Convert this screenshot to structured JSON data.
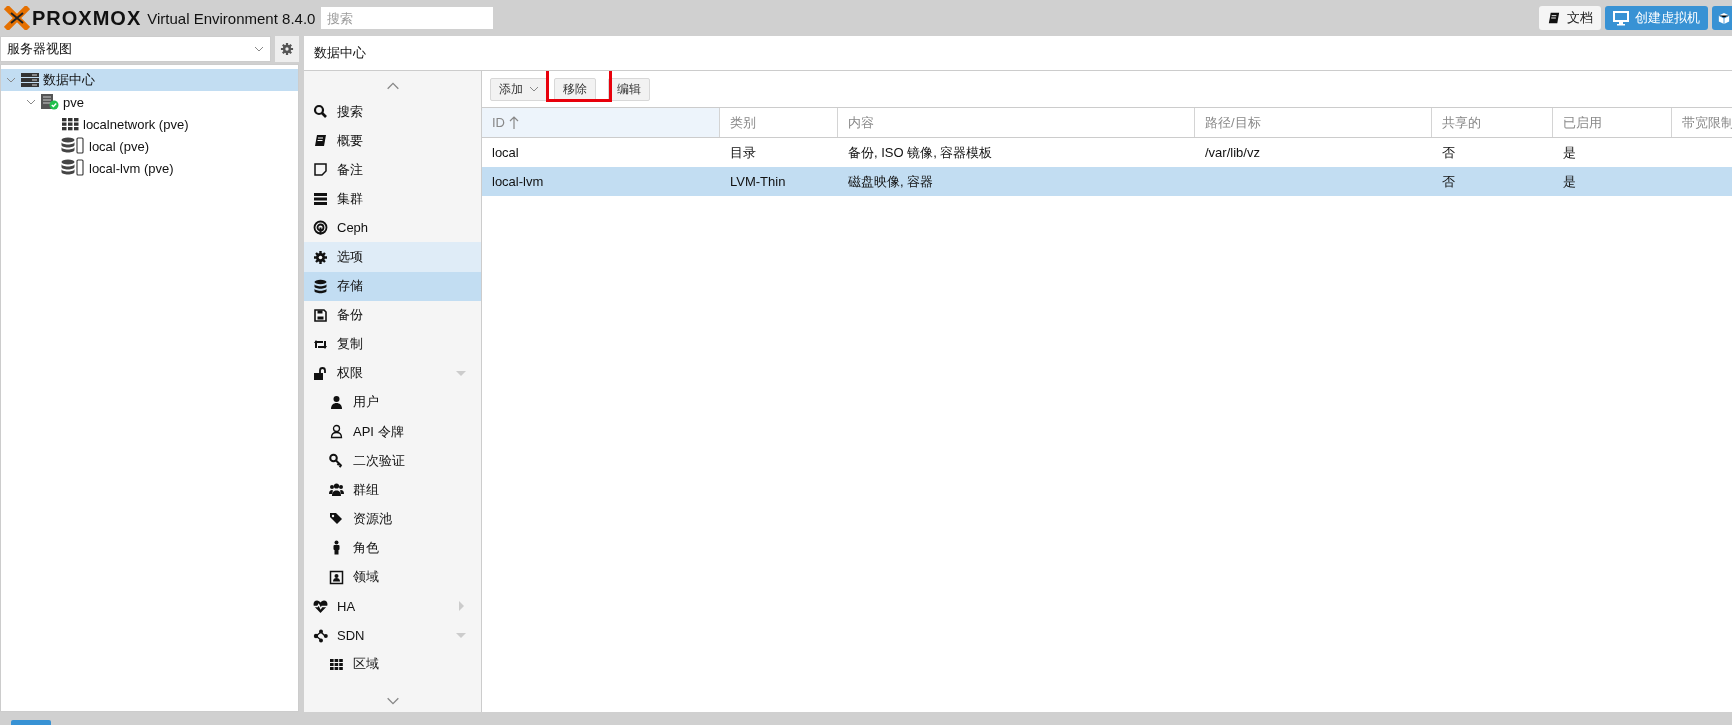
{
  "header": {
    "logo_text": "PROXMOX",
    "product": "Virtual Environment 8.4.0",
    "search": {
      "placeholder": "搜索"
    },
    "buttons": [
      {
        "kind": "docs",
        "label": "文档"
      },
      {
        "kind": "create-vm",
        "label": "创建虚拟机"
      },
      {
        "kind": "create-ct"
      }
    ]
  },
  "sidebar": {
    "view_select": {
      "value": "服务器视图"
    },
    "tree": [
      {
        "kind": "datacenter",
        "label": "数据中心",
        "selected": true,
        "expanded": true,
        "children": [
          {
            "kind": "node",
            "label": "pve",
            "selected": false,
            "expanded": true,
            "online": true,
            "children": [
              {
                "kind": "sdn",
                "label": "localnetwork (pve)",
                "selected": false
              },
              {
                "kind": "storage",
                "label": "local (pve)",
                "selected": false
              },
              {
                "kind": "storage",
                "label": "local-lvm (pve)",
                "selected": false
              }
            ]
          }
        ]
      }
    ]
  },
  "panel_title": "数据中心",
  "nav": [
    {
      "label": "搜索",
      "selected": false,
      "hovered": false
    },
    {
      "label": "概要",
      "selected": false,
      "hovered": false
    },
    {
      "label": "备注",
      "selected": false,
      "hovered": false
    },
    {
      "label": "集群",
      "selected": false,
      "hovered": false
    },
    {
      "label": "Ceph",
      "selected": false,
      "hovered": false
    },
    {
      "label": "选项",
      "selected": false,
      "hovered": true
    },
    {
      "label": "存储",
      "selected": true,
      "hovered": false
    },
    {
      "label": "备份",
      "selected": false,
      "hovered": false
    },
    {
      "label": "复制",
      "selected": false,
      "hovered": false
    },
    {
      "label": "权限",
      "selected": false,
      "hovered": false,
      "expanded": true,
      "children": [
        {
          "label": "用户",
          "selected": false,
          "hovered": false
        },
        {
          "label": "API 令牌",
          "selected": false,
          "hovered": false
        },
        {
          "label": "二次验证",
          "selected": false,
          "hovered": false
        },
        {
          "label": "群组",
          "selected": false,
          "hovered": false
        },
        {
          "label": "资源池",
          "selected": false,
          "hovered": false
        },
        {
          "label": "角色",
          "selected": false,
          "hovered": false
        },
        {
          "label": "领域",
          "selected": false,
          "hovered": false
        }
      ]
    },
    {
      "label": "HA",
      "selected": false,
      "hovered": false,
      "expanded": false
    },
    {
      "label": "SDN",
      "selected": false,
      "hovered": false,
      "expanded": true,
      "children": [
        {
          "label": "区域",
          "selected": false,
          "hovered": false
        }
      ]
    }
  ],
  "toolbar": [
    {
      "kind": "menu",
      "label": "添加"
    },
    {
      "kind": "plain",
      "label": "移除",
      "annotated": true
    },
    {
      "kind": "plain",
      "label": "编辑"
    }
  ],
  "table": {
    "columns": [
      {
        "label": "ID",
        "sorted": true
      },
      {
        "label": "类别"
      },
      {
        "label": "内容"
      },
      {
        "label": "路径/目标"
      },
      {
        "label": "共享的"
      },
      {
        "label": "已启用"
      },
      {
        "label": "带宽限制"
      }
    ],
    "rows": [
      {
        "selected": false,
        "cells": [
          "local",
          "目录",
          "备份, ISO 镜像, 容器模板",
          "/var/lib/vz",
          "否",
          "是",
          ""
        ]
      },
      {
        "selected": true,
        "cells": [
          "local-lvm",
          "LVM-Thin",
          "磁盘映像, 容器",
          "",
          "否",
          "是",
          ""
        ]
      }
    ]
  }
}
